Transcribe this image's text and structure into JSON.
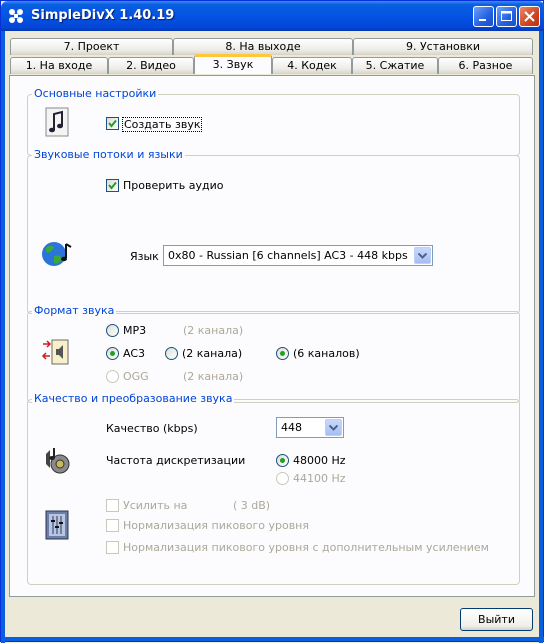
{
  "window": {
    "title": "SimpleDivX 1.40.19"
  },
  "tabs_top": [
    "7. Проект",
    "8. На выходе",
    "9. Установки"
  ],
  "tabs_bottom": [
    "1. На входе",
    "2. Видео",
    "3. Звук",
    "4. Кодек",
    "5. Сжатие",
    "6. Разное"
  ],
  "active_tab": "3. Звук",
  "basic": {
    "title": "Основные настройки",
    "create_sound": "Создать звук"
  },
  "streams": {
    "title": "Звуковые потоки и языки",
    "check_audio": "Проверить аудио",
    "language_label": "Язык",
    "language_value": "0x80 - Russian [6 channels] AC3 - 448 kbps"
  },
  "format": {
    "title": "Формат звука",
    "mp3": "MP3",
    "mp3_channels": "(2 канала)",
    "ac3": "AC3",
    "ac3_2ch": "(2 канала)",
    "ac3_6ch": "(6 каналов)",
    "ogg": "OGG",
    "ogg_channels": "(2 канала)"
  },
  "quality": {
    "title": "Качество и преобразование звука",
    "quality_label": "Качество (kbps)",
    "quality_value": "448",
    "rate_label": "Частота дискретизации",
    "rate_48": "48000 Hz",
    "rate_44": "44100 Hz",
    "amplify": "Усилить на",
    "amplify_value": "( 3 dB)",
    "normalize": "Нормализация пикового уровня",
    "normalize_plus": "Нормализация пикового уровня с дополнительным усилением"
  },
  "footer": {
    "exit_label": "Выйти"
  },
  "colors": {
    "title_bar": "#0554e3",
    "group_title": "#0046d5",
    "active_tab_accent": "#ffc83c",
    "radio_dot": "#21a121"
  }
}
